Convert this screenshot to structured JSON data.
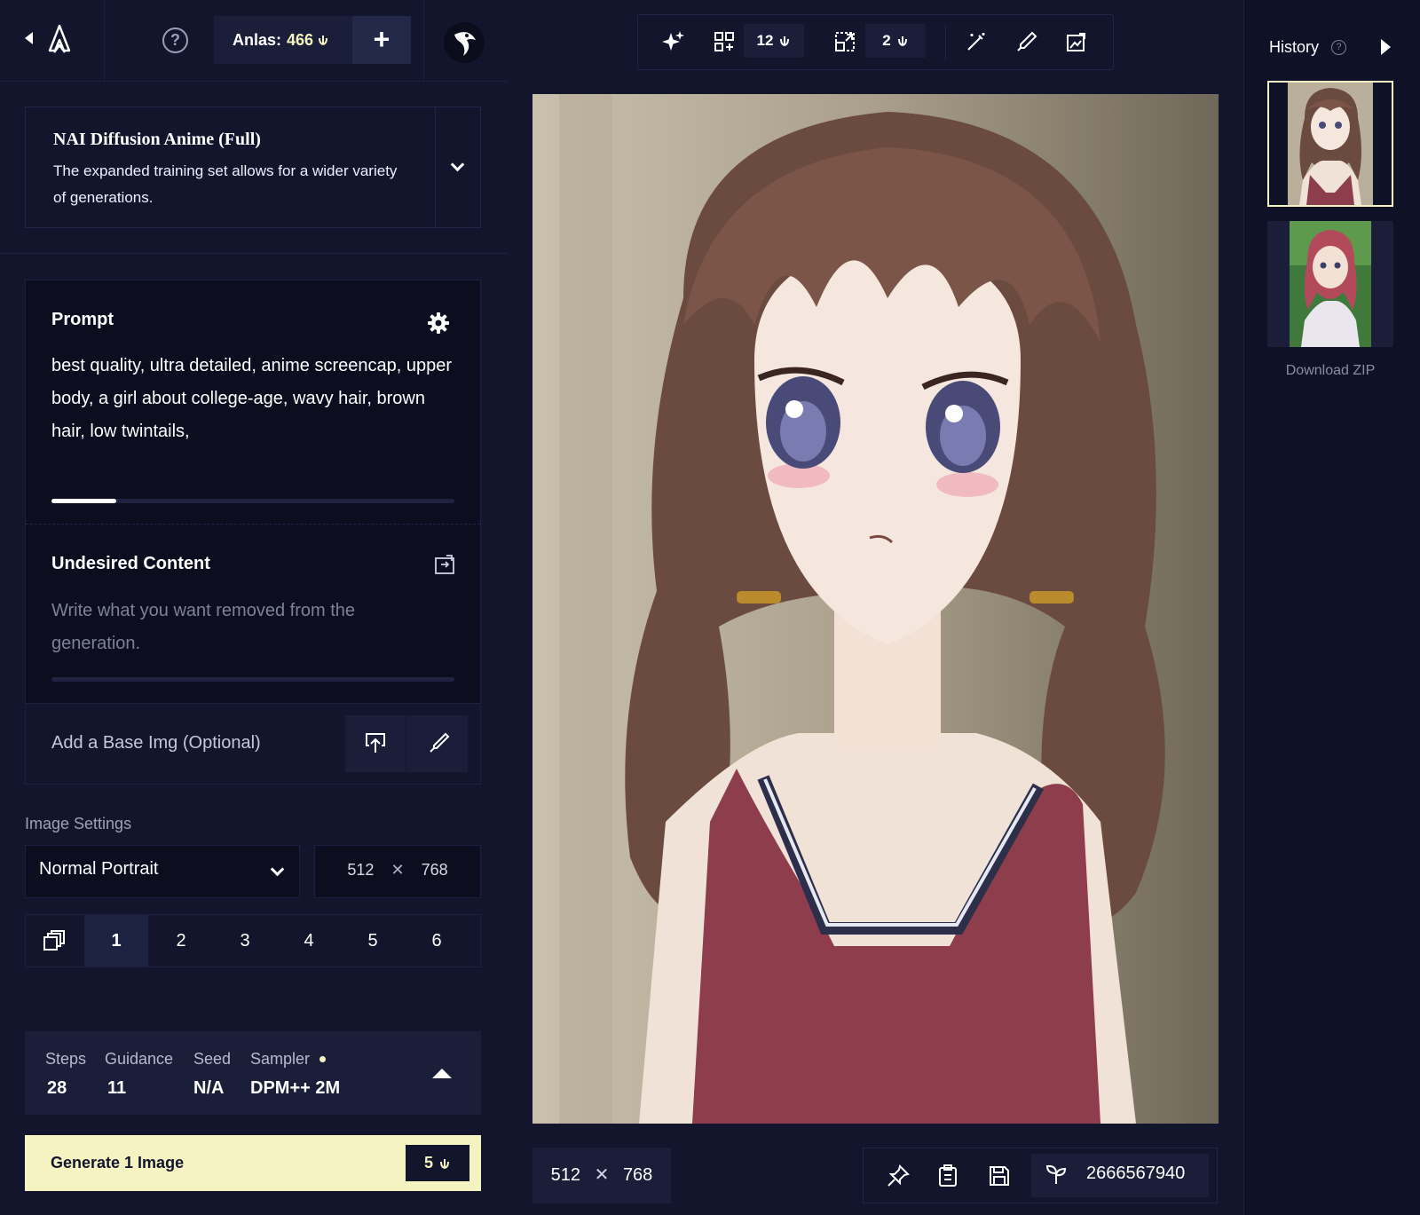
{
  "header": {
    "anlas_label": "Anlas:",
    "anlas_value": "466",
    "add_label": "+"
  },
  "model": {
    "name": "NAI Diffusion Anime (Full)",
    "description": "The expanded training set allows for a wider variety of generations."
  },
  "prompt": {
    "label": "Prompt",
    "text": "best quality,  ultra detailed,  anime screencap,  upper body,  a girl about college-age,  wavy hair,  brown hair,  low twintails,",
    "progress": 0.16
  },
  "undesired": {
    "label": "Undesired Content",
    "placeholder": "Write what you want removed from the generation."
  },
  "base_image": {
    "label": "Add a Base Img (Optional)"
  },
  "image_settings": {
    "label": "Image Settings",
    "resolution_preset": "Normal Portrait",
    "width": "512",
    "height": "768",
    "times": "✕",
    "counts": [
      "1",
      "2",
      "3",
      "4",
      "5",
      "6"
    ],
    "selected_count": "1"
  },
  "params": {
    "steps_label": "Steps",
    "steps_value": "28",
    "guidance_label": "Guidance",
    "guidance_value": "11",
    "seed_label": "Seed",
    "seed_value": "N/A",
    "sampler_label": "Sampler",
    "sampler_value": "DPM++ 2M"
  },
  "generate": {
    "label": "Generate 1 Image",
    "cost": "5"
  },
  "toolbar": {
    "variations_cost": "12",
    "upscale_cost": "2"
  },
  "result": {
    "width": "512",
    "height": "768",
    "times": "✕",
    "seed": "2666567940"
  },
  "history": {
    "title": "History",
    "help": "?",
    "download_label": "Download ZIP"
  },
  "colors": {
    "background": "#13152c",
    "accent": "#f5f3c2",
    "panel": "#1b1e38"
  }
}
